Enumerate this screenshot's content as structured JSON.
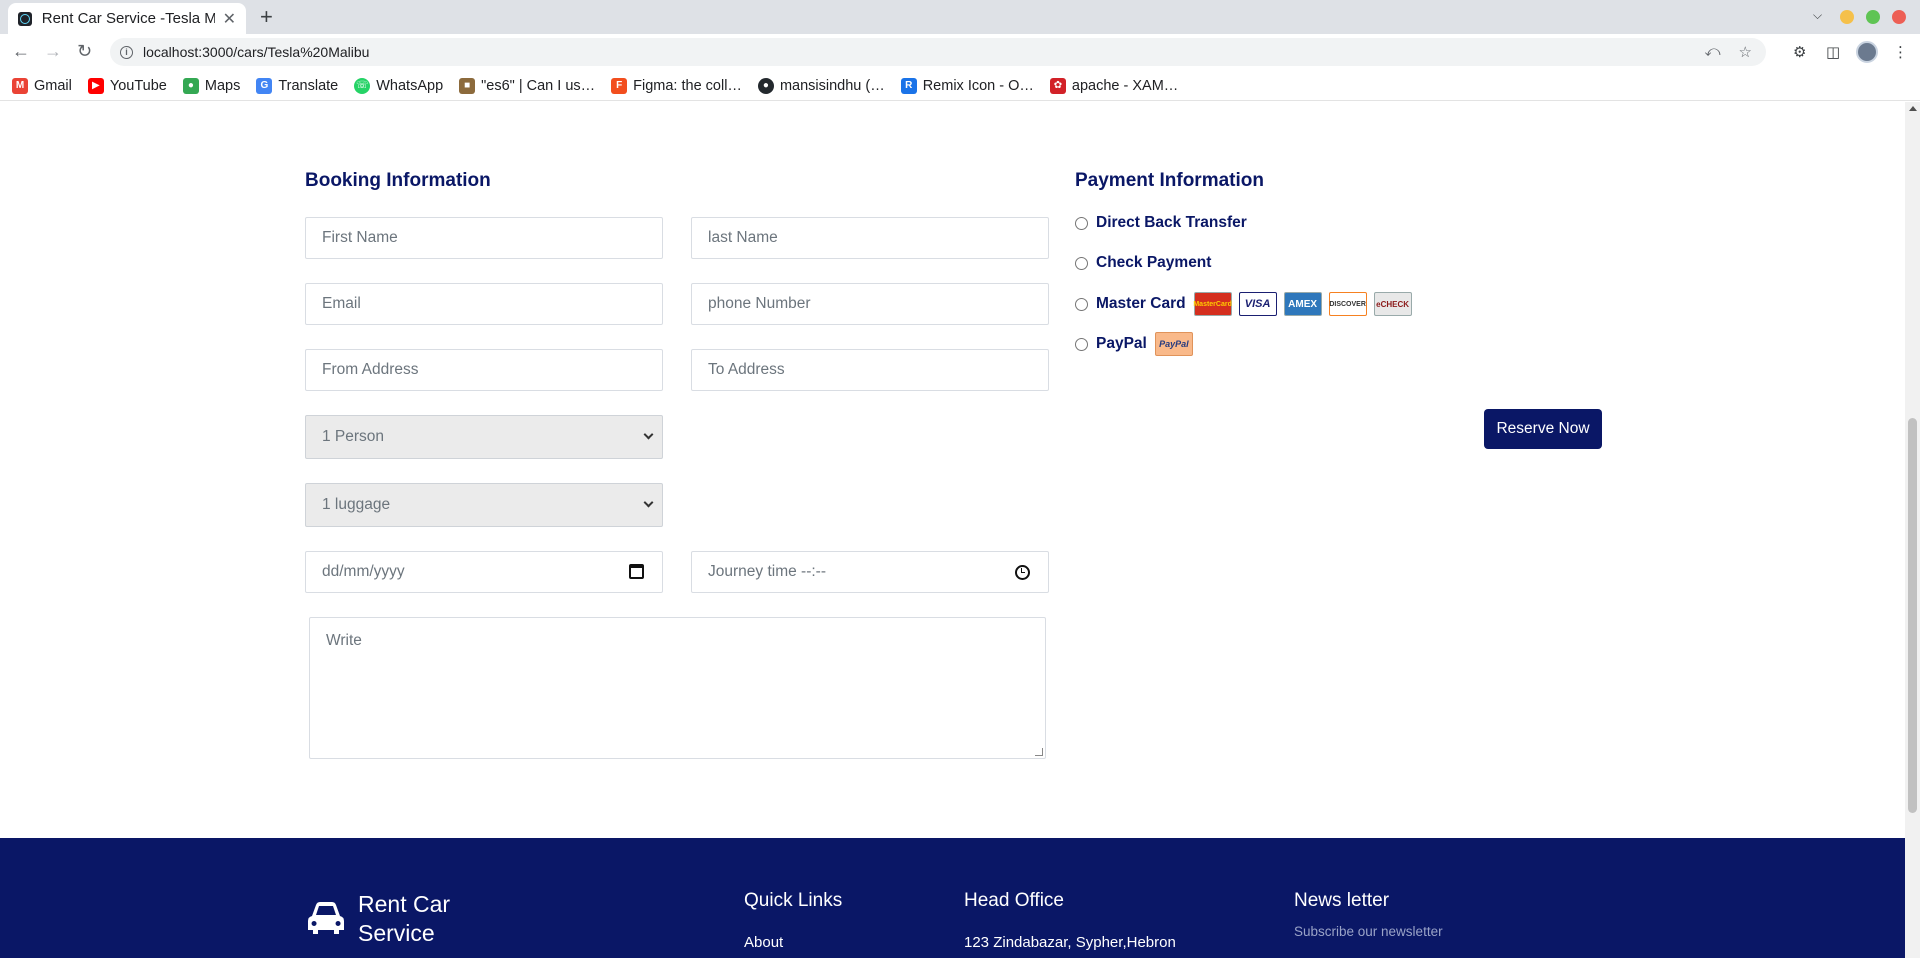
{
  "browser": {
    "tab_title": "Rent Car Service -Tesla Ma",
    "tab_close": "✕",
    "new_tab": "+",
    "url": "localhost:3000/cars/Tesla%20Malibu",
    "bookmarks": [
      "Gmail",
      "YouTube",
      "Maps",
      "Translate",
      "WhatsApp",
      "\"es6\" | Can I us…",
      "Figma: the coll…",
      "mansisindhu (…",
      "Remix Icon - O…",
      "apache - XAM…"
    ]
  },
  "booking": {
    "heading": "Booking Information",
    "first_name_placeholder": "First Name",
    "last_name_placeholder": "last Name",
    "email_placeholder": "Email",
    "phone_placeholder": "phone Number",
    "from_placeholder": "From Address",
    "to_placeholder": "To Address",
    "persons_value": "1 Person",
    "luggage_value": "1 luggage",
    "date_placeholder": "dd/mm/yyyy",
    "time_placeholder": "Journey time  --:--",
    "notes_placeholder": "Write"
  },
  "payment": {
    "heading": "Payment Information",
    "options": [
      "Direct Back Transfer",
      "Check Payment",
      "Master Card",
      "PayPal"
    ],
    "card_logos": [
      "MasterCard",
      "VISA",
      "AMEX",
      "DISCOVER",
      "eCHECK"
    ],
    "paypal_logo": "PayPal",
    "reserve_label": "Reserve Now"
  },
  "footer": {
    "brand_line1": "Rent Car",
    "brand_line2": "Service",
    "quick_links_heading": "Quick Links",
    "quick_link_1": "About",
    "head_office_heading": "Head Office",
    "address": "123 Zindabazar, Sypher,Hebron",
    "newsletter_heading": "News letter",
    "newsletter_text": "Subscribe our newsletter"
  },
  "colors": {
    "brand_navy": "#0a1766",
    "placeholder": "#6c757d"
  }
}
